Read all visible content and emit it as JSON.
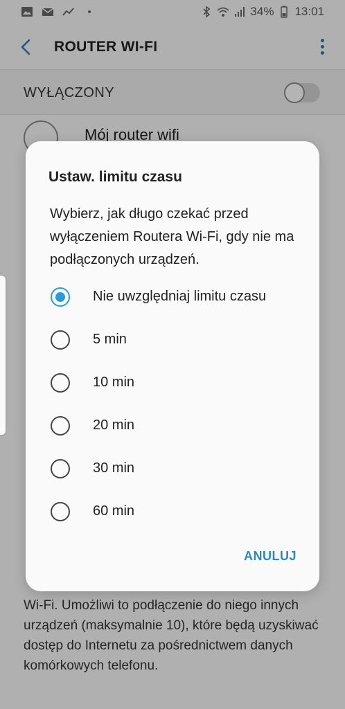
{
  "status_bar": {
    "battery_percent": "34%",
    "time": "13:01",
    "left_icons": [
      "image-icon",
      "email-icon",
      "trend-icon",
      "dot-icon"
    ],
    "right_icons": [
      "bluetooth-icon",
      "wifi-icon",
      "signal-icon",
      "battery-icon"
    ]
  },
  "header": {
    "title": "ROUTER WI-FI",
    "back_icon": "back-arrow-icon",
    "more_icon": "more-vertical-icon"
  },
  "background": {
    "switch_label": "WYŁĄCZONY",
    "switch_on": false,
    "router_name": "Mój router wifi",
    "description": "Wi-Fi. Umożliwi to podłączenie do niego innych urządzeń (maksymalnie 10), które będą uzyskiwać dostęp do Internetu za pośrednictwem danych komórkowych telefonu."
  },
  "dialog": {
    "title": "Ustaw. limitu czasu",
    "message": "Wybierz, jak długo czekać przed wyłączeniem Routera Wi-Fi, gdy nie ma podłączonych urządzeń.",
    "options": [
      {
        "label": "Nie uwzględniaj limitu czasu",
        "selected": true
      },
      {
        "label": "5 min",
        "selected": false
      },
      {
        "label": "10 min",
        "selected": false
      },
      {
        "label": "20 min",
        "selected": false
      },
      {
        "label": "30 min",
        "selected": false
      },
      {
        "label": "60 min",
        "selected": false
      }
    ],
    "cancel_label": "ANULUJ"
  },
  "colors": {
    "accent": "#2a9bd4",
    "link": "#2a8ab8"
  }
}
